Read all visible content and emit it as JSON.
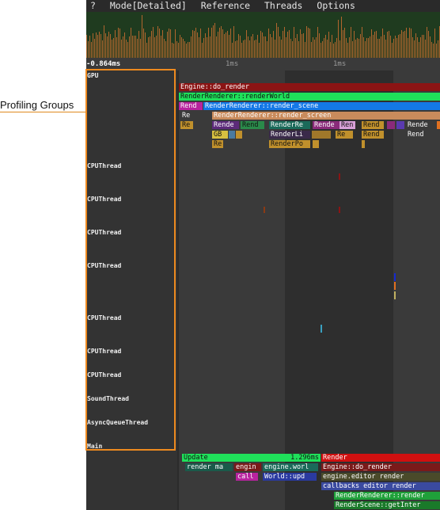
{
  "callout": {
    "label": "Profiling Groups"
  },
  "menubar": [
    "?",
    "Mode[Detailed]",
    "Reference",
    "Threads",
    "Options"
  ],
  "ruler": {
    "start": "-0.864ms",
    "tick1": "1ms",
    "tick2": "1ms"
  },
  "groups": [
    "GPU",
    "CPUThread",
    "CPUThread",
    "CPUThread",
    "CPUThread",
    "CPUThread",
    "CPUThread",
    "CPUThread",
    "SoundThread",
    "AsyncQueueThread",
    "Main"
  ],
  "gpu_timers": {
    "row1": "Engine::do_render",
    "row2": "RenderRenderer::renderWorld",
    "row3a": "Rend",
    "row3b": "RenderRenderer::render_scene",
    "row4a": "Re",
    "row4b": "RenderRenderer::render_screen",
    "row5a": "Re",
    "row5b": "Rende",
    "row5c": "Rend",
    "row5d": "RenderRe",
    "row5e": "Rende",
    "row5f": "Ren",
    "row5g": "Rend",
    "row5h": "Rende",
    "row6a": "GB",
    "row6b": "RenderLi",
    "row6c": "Re",
    "row6d": "Rend",
    "row6e": "Rend",
    "row7a": "Re",
    "row7b": "RenderPo"
  },
  "main_timers": {
    "update": "Update",
    "update_time": "1.296ms",
    "render": "Render",
    "render_ma": "render ma",
    "engin": "engin",
    "engine_worl": "engine.worl",
    "engine_do_render": "Engine::do_render",
    "call": "call",
    "world_upd": "World::upd",
    "engine_editor_render": "engine.editor render",
    "callbacks_editor_render": "callbacks editor render",
    "renderrenderer_render": "RenderRenderer::render",
    "renderscene_getinter": "RenderScene::getInter"
  },
  "colors": {
    "accent": "#ee8a1f",
    "histogram": "#b1662e",
    "histogram_bg": "#1f3b1f"
  }
}
